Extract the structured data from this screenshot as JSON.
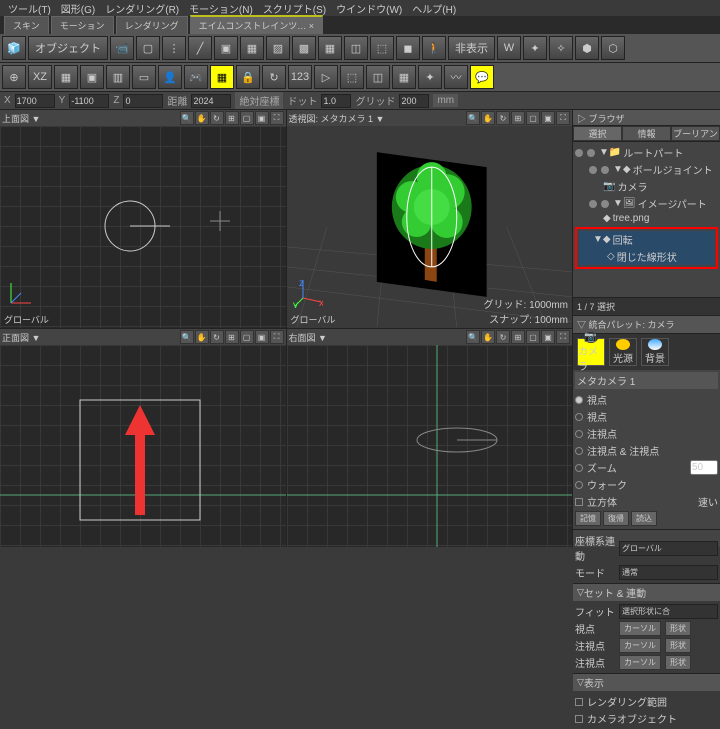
{
  "menubar": [
    "ツール(T)",
    "図形(G)",
    "レンダリング(R)",
    "モーション(N)",
    "スクリプト(S)",
    "ウインドウ(W)",
    "ヘルプ(H)"
  ],
  "doc_tabs": [
    {
      "label": "スキン"
    },
    {
      "label": "モーション"
    },
    {
      "label": "レンダリング"
    },
    {
      "label": "エイムコンストレインツ…  ×",
      "active": true
    }
  ],
  "toolbar1": {
    "object_label": "オブジェクト",
    "hide_label": "非表示"
  },
  "coords": {
    "x_lbl": "X",
    "x": "1700",
    "y_lbl": "Y",
    "y": "-1100",
    "z_lbl": "Z",
    "z": "0",
    "dist_lbl": "距離",
    "dist": "2024",
    "mode": "絶対座標",
    "dot_lbl": "ドット",
    "dot": "1.0",
    "grid_lbl": "グリッド",
    "grid": "200",
    "unit": "mm"
  },
  "viewports": {
    "top": {
      "title": "上面図 ▼",
      "footer": "グローバル"
    },
    "persp": {
      "title": "透視図: メタカメラ 1 ▼",
      "footer": "グローバル",
      "grid_info": "グリッド: 1000mm",
      "snap_info": "スナップ: 100mm"
    },
    "front": {
      "title": "正面図 ▼"
    },
    "right": {
      "title": "右面図 ▼"
    }
  },
  "browser": {
    "title": "▷ ブラウザ",
    "tabs": [
      "選択",
      "情報",
      "ブーリアン"
    ],
    "tree": [
      {
        "label": "ルートパート",
        "indent": 0,
        "icon": "📁"
      },
      {
        "label": "ボールジョイント",
        "indent": 1,
        "icon": "◆"
      },
      {
        "label": "カメラ",
        "indent": 2,
        "icon": "📷"
      },
      {
        "label": "イメージパート",
        "indent": 1,
        "icon": "🖼"
      },
      {
        "label": "tree.png",
        "indent": 2,
        "icon": "◆"
      }
    ],
    "highlight": [
      {
        "label": "回転",
        "icon": "◆"
      },
      {
        "label": "閉じた線形状",
        "icon": "◇"
      }
    ]
  },
  "sel_count": "1 / 7 選択",
  "palette": {
    "header": "▽ 統合パレット: カメラ",
    "items": [
      {
        "label": "カメラ",
        "active": true
      },
      {
        "label": "光源"
      },
      {
        "label": "背景"
      }
    ]
  },
  "camera_props": {
    "title": "メタカメラ 1",
    "opts": [
      "視点",
      "視点",
      "注視点",
      "注視点 & 注視点",
      "ズーム",
      "ウォーク"
    ],
    "zoom_val": "50",
    "cube_lbl": "立方体",
    "speed_lbl": "速い",
    "buttons": [
      "記憶",
      "復帰",
      "読込"
    ]
  },
  "linkage": {
    "coord_lbl": "座標系連動",
    "coord_val": "グローバル",
    "mode_lbl": "モード",
    "mode_val": "通常"
  },
  "setmove": {
    "header": "セット & 連動",
    "rows": [
      {
        "lbl": "フィット",
        "val": "選択形状に合"
      },
      {
        "lbl": "視点",
        "b1": "カーソル",
        "b2": "形状"
      },
      {
        "lbl": "注視点",
        "b1": "カーソル",
        "b2": "形状"
      },
      {
        "lbl": "注視点",
        "b1": "カーソル",
        "b2": "形状"
      }
    ]
  },
  "display": {
    "header": "表示",
    "render_range": "レンダリング範囲",
    "cam_obj": "カメラオブジェクト"
  }
}
